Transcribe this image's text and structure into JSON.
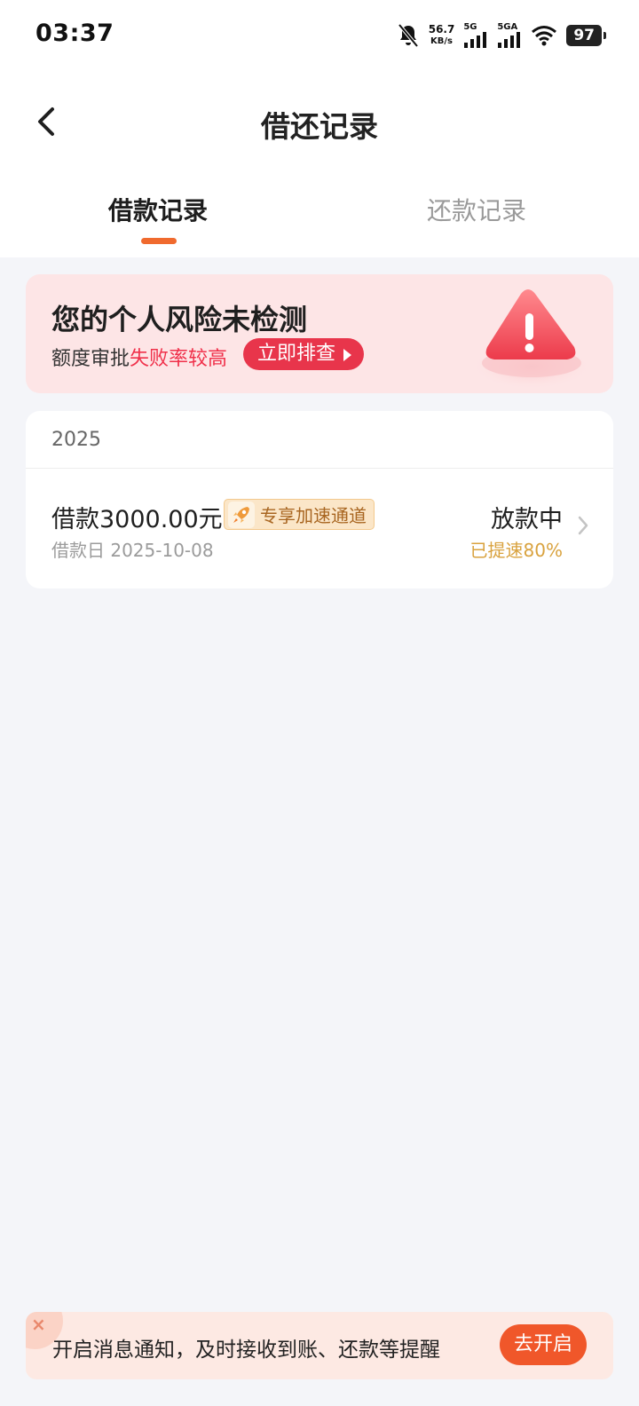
{
  "status_bar": {
    "time": "03:37",
    "net_speed_value": "56.7",
    "net_speed_unit": "KB/s",
    "sim1_label": "5G",
    "sim2_label": "5GA",
    "battery": "97",
    "icons": [
      "mute-bell-icon",
      "signal-icon",
      "signal-icon",
      "wifi-icon",
      "battery-icon"
    ]
  },
  "header": {
    "title": "借还记录",
    "back_icon": "chevron-left-icon"
  },
  "tabs": [
    {
      "label": "借款记录",
      "active": true
    },
    {
      "label": "还款记录",
      "active": false
    }
  ],
  "risk_banner": {
    "title": "您的个人风险未检测",
    "subtitle_prefix": "额度审批",
    "subtitle_warning": "失败率较高",
    "button_label": "立即排查",
    "icon": "warning-triangle-icon"
  },
  "records": {
    "year": "2025",
    "items": [
      {
        "title": "借款3000.00元",
        "badge": "专享加速通道",
        "date": "借款日 2025-10-08",
        "status": "放款中",
        "progress": "已提速80%"
      }
    ]
  },
  "notify": {
    "text": "开启消息通知，及时接收到账、还款等提醒",
    "button_label": "去开启",
    "close_glyph": "×"
  },
  "colors": {
    "accent": "#f06a2e",
    "risk_red": "#e8354b",
    "page_bg": "#f4f5f9",
    "gold": "#d9a23e"
  }
}
